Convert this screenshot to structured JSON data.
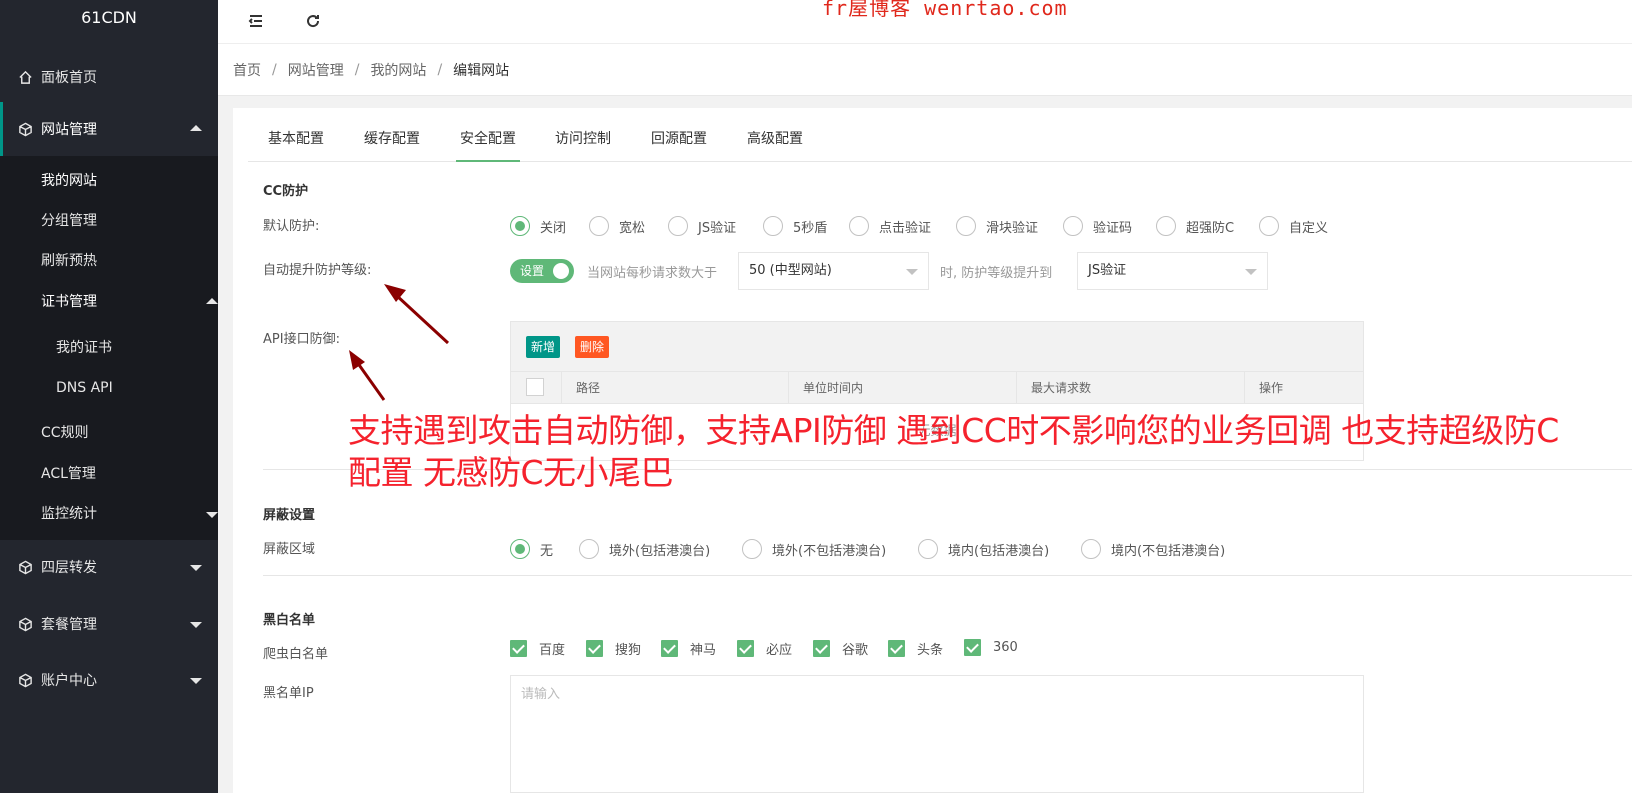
{
  "app": {
    "logo": "61CDN",
    "watermark": "fr屋博客 wenrtao.com"
  },
  "sidebar": {
    "dashboard": "面板首页",
    "site_mgmt": "网站管理",
    "sub": {
      "my_sites": "我的网站",
      "groups": "分组管理",
      "refresh": "刷新预热",
      "cert_mgmt": "证书管理",
      "my_certs": "我的证书",
      "dns_api": "DNS API",
      "cc_rules": "CC规则",
      "acl": "ACL管理",
      "monitor": "监控统计"
    },
    "l4_forward": "四层转发",
    "packages": "套餐管理",
    "account": "账户中心"
  },
  "breadcrumb": [
    "首页",
    "网站管理",
    "我的网站",
    "编辑网站"
  ],
  "tabs": [
    "基本配置",
    "缓存配置",
    "安全配置",
    "访问控制",
    "回源配置",
    "高级配置"
  ],
  "cc": {
    "title": "CC防护",
    "default_label": "默认防护:",
    "options": [
      "关闭",
      "宽松",
      "JS验证",
      "5秒盾",
      "点击验证",
      "滑块验证",
      "验证码",
      "超强防C",
      "自定义"
    ],
    "selected": "关闭",
    "auto_label": "自动提升防护等级:",
    "switch_label": "设置",
    "when_text": "当网站每秒请求数大于",
    "threshold": "50 (中型网站)",
    "then_text": "时, 防护等级提升到",
    "level": "JS验证",
    "api_label": "API接口防御:",
    "add_btn": "新增",
    "del_btn": "删除",
    "columns": [
      "路径",
      "单位时间内",
      "最大请求数",
      "操作"
    ],
    "empty": "无数据"
  },
  "block": {
    "title": "屏蔽设置",
    "region_label": "屏蔽区域",
    "options": [
      "无",
      "境外(包括港澳台)",
      "境外(不包括港澳台)",
      "境内(包括港澳台)",
      "境内(不包括港澳台)"
    ],
    "selected": "无"
  },
  "bw": {
    "title": "黑白名单",
    "crawler_label": "爬虫白名单",
    "crawlers": [
      "百度",
      "搜狗",
      "神马",
      "必应",
      "谷歌",
      "头条",
      "360"
    ],
    "ip_label": "黑名单IP",
    "ip_placeholder": "请输入"
  },
  "annotation": "支持遇到攻击自动防御，支持API防御 遇到CC时不影响您的业务回调 也支持超级防C配置 无感防C无小尾巴",
  "colors": {
    "accent": "#5fb878",
    "sidebar": "#23262e",
    "annotation": "#f5222d"
  }
}
